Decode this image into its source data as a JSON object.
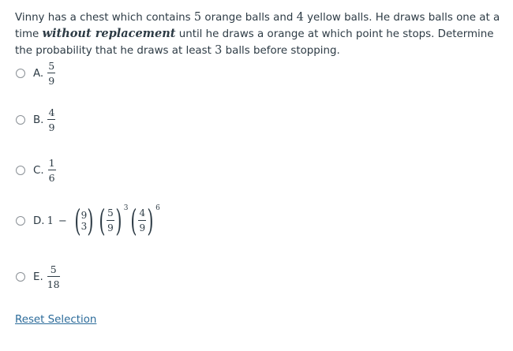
{
  "question": {
    "part1": "Vinny has a chest which contains ",
    "orange_count": "5",
    "part2": " orange balls and ",
    "yellow_count": "4",
    "part3": " yellow balls. He draws balls one at a time ",
    "emphasis": "without replacement",
    "part4": " until he draws a orange at which point he stops. Determine the probability that he draws at least ",
    "at_least": "3",
    "part5": " balls before stopping."
  },
  "choices": [
    {
      "label": "A.",
      "numerator": "5",
      "denominator": "9"
    },
    {
      "label": "B.",
      "numerator": "4",
      "denominator": "9"
    },
    {
      "label": "C.",
      "numerator": "1",
      "denominator": "6"
    },
    {
      "label": "D.",
      "one": "1",
      "minus": "−",
      "binom_top": "9",
      "binom_bottom": "3",
      "f1_num": "5",
      "f1_den": "9",
      "exp1": "3",
      "f2_num": "4",
      "f2_den": "9",
      "exp2": "6"
    },
    {
      "label": "E.",
      "numerator": "5",
      "denominator": "18"
    }
  ],
  "reset_label": "Reset Selection"
}
